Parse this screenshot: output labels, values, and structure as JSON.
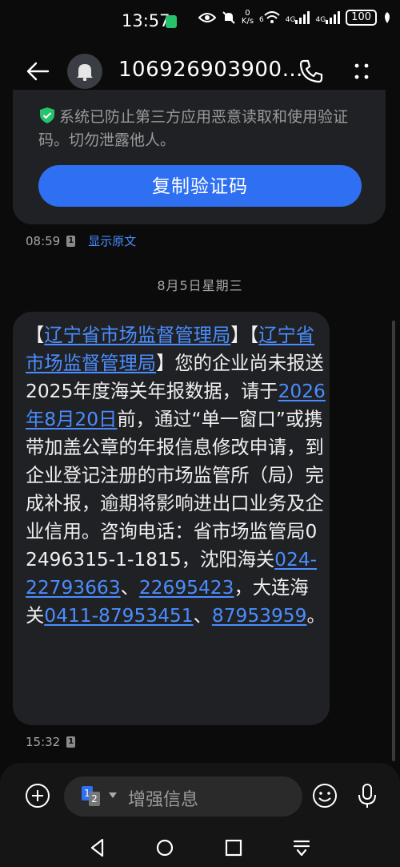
{
  "status_bar": {
    "time": "13:57",
    "net_speed_top": "0",
    "net_speed_unit": "K/s",
    "wifi_label": "6",
    "sig1_label": "4G",
    "sig2_label": "4G",
    "battery": "100"
  },
  "header": {
    "title": "106926903900…",
    "avatar_icon": "bell-icon"
  },
  "prev_message": {
    "notice": "系统已防止第三方应用恶意读取和使用验证码。切勿泄露他人。",
    "copy_button": "复制验证码",
    "time": "08:59",
    "sim_slot": "1",
    "show_original": "显示原文"
  },
  "date_separator": "8月5日星期三",
  "message": {
    "p1": "【",
    "link1": "辽宁省市场监督管理局",
    "p2": "】【",
    "link2": "辽宁省市场监督管理局",
    "p3": "】您的企业尚未报送2025年度海关年报数据，请于",
    "link3": "2026年8月20日",
    "p4": "前，通过“单一窗口”或携带加盖公章的年报信息修改申请，到企业登记注册的市场监管所（局）完成补报，逾期将影响进出口业务及企业信用。咨询电话：省市场监管局02496315-1-1815，沈阳海关",
    "link4": "024-22793663",
    "p5": "、",
    "link5": "22695423",
    "p6": "，大连海关",
    "link6": "0411-87953451",
    "p7": "、",
    "link7": "87953959",
    "p8": "。",
    "time": "15:32",
    "sim_slot": "1"
  },
  "composer": {
    "placeholder": "增强信息",
    "sim_label_1": "1",
    "sim_label_2": "2"
  },
  "colors": {
    "background": "#0b0b0b",
    "bubble": "#202124",
    "accent": "#2f6ff2",
    "link": "#4a8dff",
    "shield": "#27c26c"
  }
}
